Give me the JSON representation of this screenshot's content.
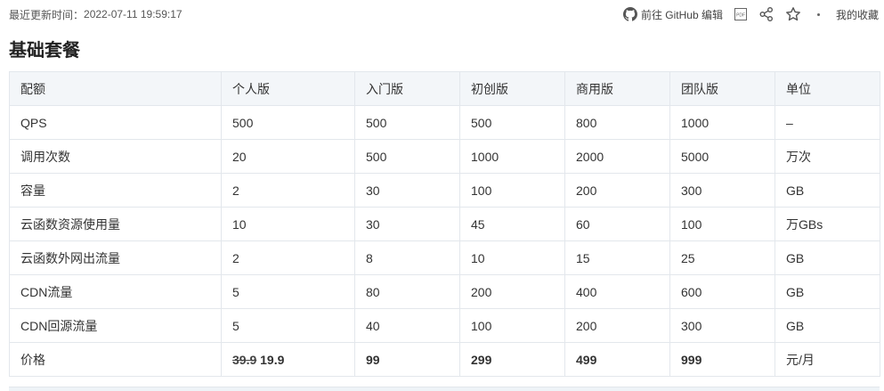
{
  "topbar": {
    "updated_label": "最近更新时间：",
    "updated_time": "2022-07-11 19:59:17",
    "github_edit": "前往 GitHub 编辑",
    "pdf_icon_text": "PDF",
    "favorites": "我的收藏",
    "icons": [
      "github-icon",
      "pdf-icon",
      "share-icon",
      "star-icon",
      "dot-icon"
    ]
  },
  "section_title": "基础套餐",
  "table": {
    "headers": [
      "配额",
      "个人版",
      "入门版",
      "初创版",
      "商用版",
      "团队版",
      "单位"
    ],
    "rows": [
      [
        "QPS",
        "500",
        "500",
        "500",
        "800",
        "1000",
        "–"
      ],
      [
        "调用次数",
        "20",
        "500",
        "1000",
        "2000",
        "5000",
        "万次"
      ],
      [
        "容量",
        "2",
        "30",
        "100",
        "200",
        "300",
        "GB"
      ],
      [
        "云函数资源使用量",
        "10",
        "30",
        "45",
        "60",
        "100",
        "万GBs"
      ],
      [
        "云函数外网出流量",
        "2",
        "8",
        "10",
        "15",
        "25",
        "GB"
      ],
      [
        "CDN流量",
        "5",
        "80",
        "200",
        "400",
        "600",
        "GB"
      ],
      [
        "CDN回源流量",
        "5",
        "40",
        "100",
        "200",
        "300",
        "GB"
      ]
    ],
    "price_row": {
      "label": "价格",
      "personal_original": "39.9",
      "personal_price": "19.9",
      "starter": "99",
      "startup": "299",
      "business": "499",
      "team": "999",
      "unit": "元/月"
    }
  },
  "colors": {
    "header_bg": "#f3f6f9",
    "border": "#e3e7ec",
    "text": "#333333"
  }
}
